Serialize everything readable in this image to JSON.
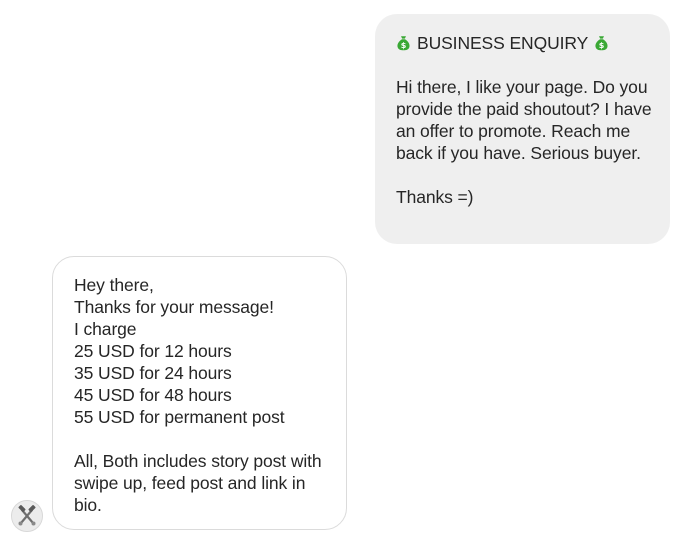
{
  "conversation": {
    "outgoing": {
      "heading_icon": "money-bag-icon",
      "heading": "BUSINESS ENQUIRY",
      "body": "Hi there, I like your page. Do you provide the paid shoutout? I have an offer to promote. Reach me back if you have. Serious buyer.",
      "signoff": "Thanks =)"
    },
    "incoming": {
      "greeting": "Hey there,",
      "thanks": "Thanks for your message!",
      "intro": "I charge",
      "prices": [
        "25 USD for 12 hours",
        "35 USD for 24 hours",
        "45 USD for 48 hours",
        "55 USD for permanent post"
      ],
      "note": "All, Both includes story post with swipe up, feed post and link in bio."
    },
    "sender_avatar_icon": "crossed-tools-avatar-icon"
  },
  "colors": {
    "outgoing_bubble": "#efefef",
    "incoming_border": "#dbdbdb",
    "text": "#262626",
    "money_bag": "#3aa835"
  }
}
